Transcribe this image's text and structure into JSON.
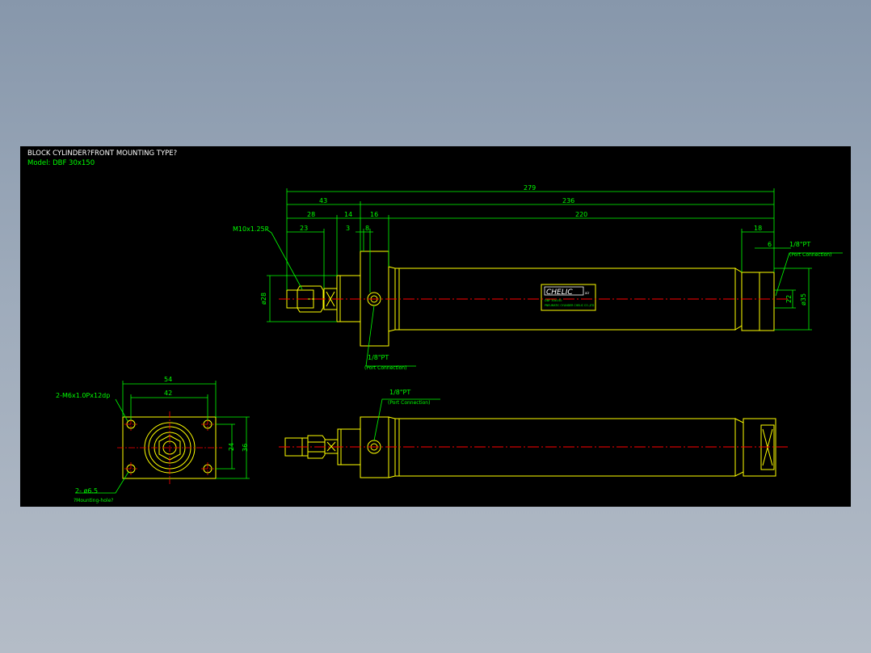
{
  "title": {
    "line1": "BLOCK CYLINDER?FRONT MOUNTING TYPE?",
    "line2": "Model: DBF 30x150"
  },
  "dims": {
    "d279": "279",
    "d43": "43",
    "d236": "236",
    "d28": "28",
    "d14": "14",
    "d16": "16",
    "d220": "220",
    "d23": "23",
    "d3": "3",
    "d8": "8",
    "d18": "18",
    "d6": "6",
    "d22": "22",
    "dphi35": "ø35",
    "dphi28": "ø28",
    "d54": "54",
    "d42": "42",
    "d24": "24",
    "d36": "36"
  },
  "labels": {
    "thread": "M10x1.25P",
    "port": "1/8\"PT",
    "port_note": "(Port Connection)",
    "tap": "2-M6x1.0Px12dp",
    "hole": "2- ø6.5",
    "hole_note": "?Mounting-hole?",
    "logo": "CHELIC",
    "logo_sub": "air",
    "plate1": "DBF 30x150",
    "plate2": "PNEUMATIC CYLINDER  CHELIC CO.,LTD"
  },
  "colors": {
    "background": "#000000",
    "outline": "#ffff00",
    "dimension": "#00ff00",
    "centerline": "#ff0000",
    "text": "#ffffff"
  }
}
